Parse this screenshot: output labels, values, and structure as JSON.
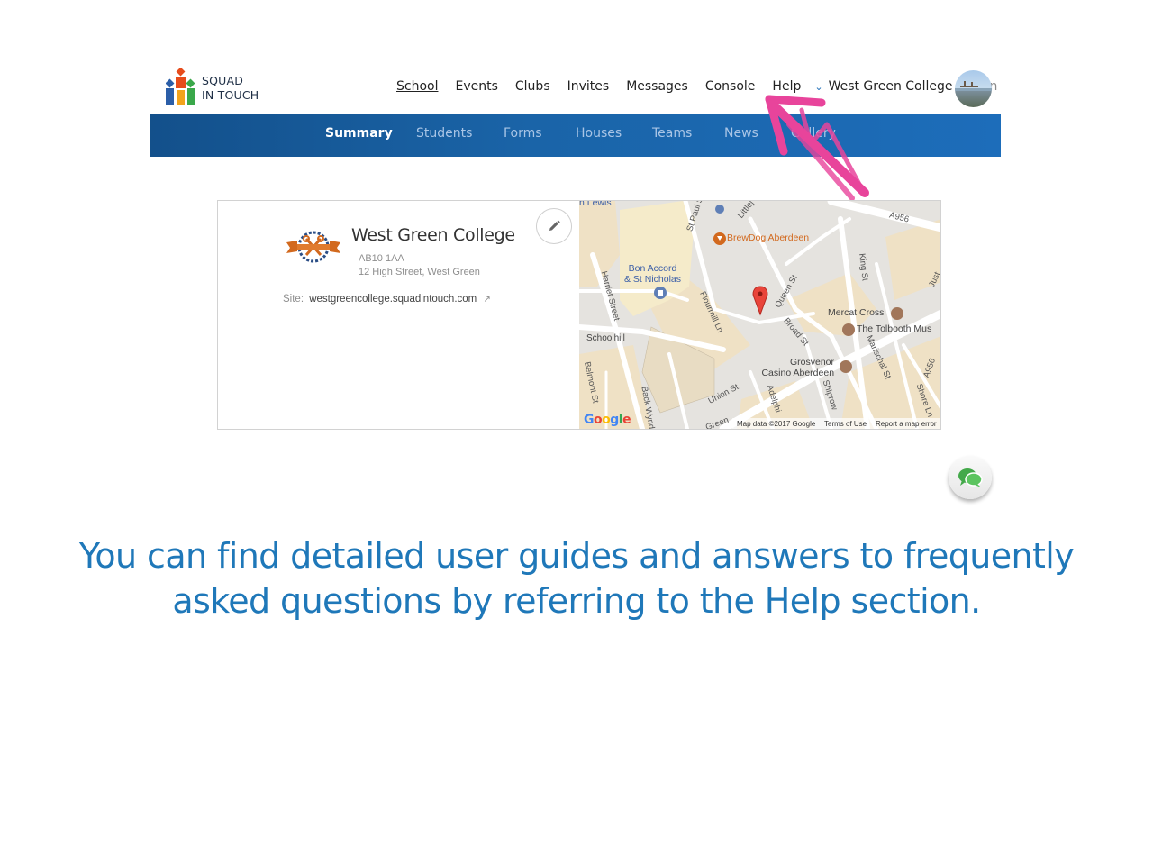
{
  "brand": {
    "line1": "SQUAD",
    "line2": "IN TOUCH",
    "colors": [
      "#e74c1c",
      "#2b5ea8",
      "#f2a31b",
      "#3aa84a"
    ]
  },
  "top_nav": {
    "items": [
      "School",
      "Events",
      "Clubs",
      "Invites",
      "Messages",
      "Console",
      "Help"
    ],
    "active": "School",
    "school_name": "West Green College",
    "role": "admin"
  },
  "sub_nav": {
    "items": [
      "Summary",
      "Students",
      "Forms",
      "Houses",
      "Teams",
      "News",
      "Gallery"
    ],
    "active": "Summary",
    "bar_color": "#1a64a8"
  },
  "school_card": {
    "name": "West Green College",
    "postcode": "AB10 1AA",
    "street": "12 High Street, West Green",
    "site_label": "Site:",
    "site_url": "westgreencollege.squadintouch.com",
    "edit_icon": "pencil-icon",
    "external_icon": "external-link-icon"
  },
  "map": {
    "places": {
      "brewdog": "BrewDog Aberdeen",
      "bon_accord_1": "Bon Accord",
      "bon_accord_2": "& St Nicholas",
      "mercat": "Mercat Cross",
      "tolbooth": "The Tolbooth Mus",
      "grosvenor_1": "Grosvenor",
      "grosvenor_2": "Casino Aberdeen",
      "lewis": "n Lewis",
      "schoolhill": "Schoolhill"
    },
    "roads": {
      "a956_top": "A956",
      "a956_right": "A956",
      "king": "King St",
      "queen": "Queen St",
      "broad": "Broad St",
      "marischal": "Marischal St",
      "flourmill": "Flourmill Ln",
      "harriet": "Harriet Street",
      "belmont": "Belmont St",
      "back_wynd": "Back Wynd",
      "union": "Union St",
      "adelphi": "Adelphi",
      "shiprow": "Shiprow",
      "shore": "Shore Ln",
      "st_paul": "St Paul St",
      "littlejohn": "Littlej",
      "green": "Green",
      "just": "Just"
    },
    "google": [
      "G",
      "o",
      "o",
      "g",
      "l",
      "e"
    ],
    "google_colors": [
      "#4285f4",
      "#ea4335",
      "#fbbc05",
      "#4285f4",
      "#34a853",
      "#ea4335"
    ],
    "map_data": "Map data ©2017 Google",
    "terms": "Terms of Use",
    "report": "Report a map error"
  },
  "chat_icon": "chat-bubbles-icon",
  "caption": {
    "line1": "You can find detailed user guides and answers to frequently",
    "line2": "asked questions by referring to the Help section."
  },
  "annotation_color": "#e8449b"
}
